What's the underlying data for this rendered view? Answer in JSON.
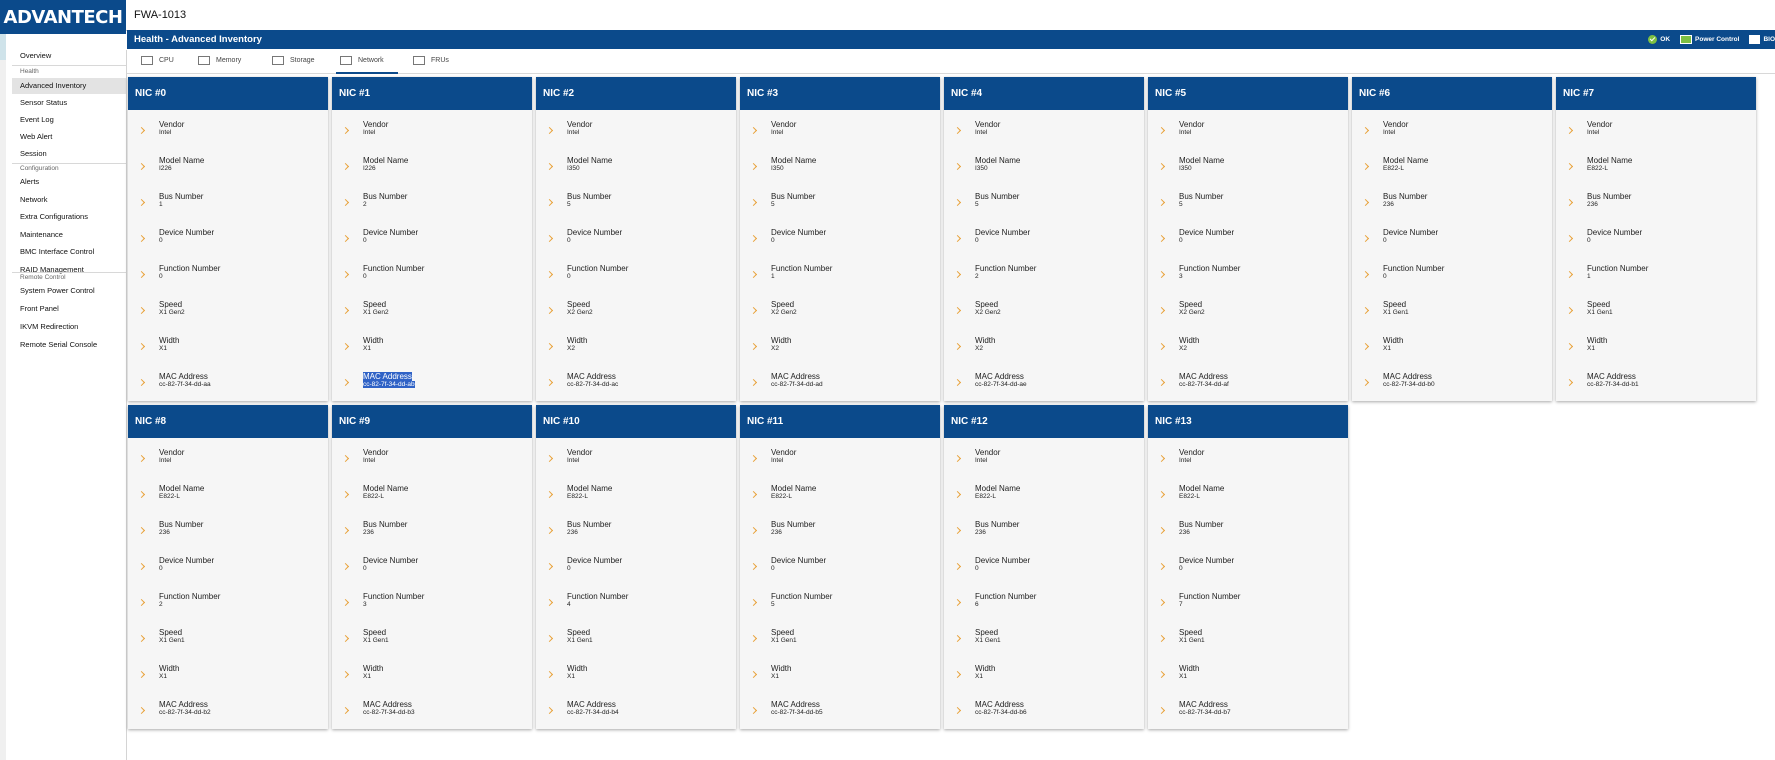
{
  "brand": {
    "logo_text": "ADVANTECH",
    "product": "FWA-1013"
  },
  "page_header": {
    "title": "Health - Advanced Inventory",
    "status": [
      {
        "label": "OK",
        "icon": "ok-check-icon"
      },
      {
        "label": "Power Control",
        "icon": "power-icon"
      },
      {
        "label": "BIO",
        "icon": "bios-icon"
      }
    ]
  },
  "tabs": [
    {
      "label": "CPU",
      "icon": "cpu-icon"
    },
    {
      "label": "Memory",
      "icon": "memory-icon"
    },
    {
      "label": "Storage",
      "icon": "storage-icon"
    },
    {
      "label": "Network",
      "icon": "network-icon",
      "active": true
    },
    {
      "label": "FRUs",
      "icon": "fru-icon"
    }
  ],
  "sidebar": {
    "overview": "Overview",
    "health_section": "Health",
    "health_items": [
      "Advanced Inventory",
      "Sensor Status",
      "Event Log",
      "Web Alert",
      "Session"
    ],
    "config_section": "Configuration",
    "config_items": [
      "Alerts",
      "Network",
      "Extra Configurations",
      "Maintenance",
      "BMC Interface Control",
      "RAID Management"
    ],
    "remote_section": "Remote Control",
    "remote_items": [
      "System Power Control",
      "Front Panel",
      "IKVM Redirection",
      "Remote Serial Console"
    ],
    "active_item": "Advanced Inventory"
  },
  "field_labels": {
    "vendor": "Vendor",
    "model": "Model Name",
    "bus": "Bus Number",
    "device": "Device Number",
    "function": "Function Number",
    "speed": "Speed",
    "width": "Width",
    "mac": "MAC Address"
  },
  "nics": [
    {
      "title": "NIC #0",
      "vendor": "Intel",
      "model": "I226",
      "bus": "1",
      "device": "0",
      "function": "0",
      "speed": "X1 Gen2",
      "width": "X1",
      "mac": "cc-82-7f-34-dd-aa"
    },
    {
      "title": "NIC #1",
      "vendor": "Intel",
      "model": "I226",
      "bus": "2",
      "device": "0",
      "function": "0",
      "speed": "X1 Gen2",
      "width": "X1",
      "mac": "cc-82-7f-34-dd-ab",
      "selected": true
    },
    {
      "title": "NIC #2",
      "vendor": "Intel",
      "model": "I350",
      "bus": "5",
      "device": "0",
      "function": "0",
      "speed": "X2 Gen2",
      "width": "X2",
      "mac": "cc-82-7f-34-dd-ac"
    },
    {
      "title": "NIC #3",
      "vendor": "Intel",
      "model": "I350",
      "bus": "5",
      "device": "0",
      "function": "1",
      "speed": "X2 Gen2",
      "width": "X2",
      "mac": "cc-82-7f-34-dd-ad"
    },
    {
      "title": "NIC #4",
      "vendor": "Intel",
      "model": "I350",
      "bus": "5",
      "device": "0",
      "function": "2",
      "speed": "X2 Gen2",
      "width": "X2",
      "mac": "cc-82-7f-34-dd-ae"
    },
    {
      "title": "NIC #5",
      "vendor": "Intel",
      "model": "I350",
      "bus": "5",
      "device": "0",
      "function": "3",
      "speed": "X2 Gen2",
      "width": "X2",
      "mac": "cc-82-7f-34-dd-af"
    },
    {
      "title": "NIC #6",
      "vendor": "Intel",
      "model": "E822-L",
      "bus": "236",
      "device": "0",
      "function": "0",
      "speed": "X1 Gen1",
      "width": "X1",
      "mac": "cc-82-7f-34-dd-b0"
    },
    {
      "title": "NIC #7",
      "vendor": "Intel",
      "model": "E822-L",
      "bus": "236",
      "device": "0",
      "function": "1",
      "speed": "X1 Gen1",
      "width": "X1",
      "mac": "cc-82-7f-34-dd-b1"
    },
    {
      "title": "NIC #8",
      "vendor": "Intel",
      "model": "E822-L",
      "bus": "236",
      "device": "0",
      "function": "2",
      "speed": "X1 Gen1",
      "width": "X1",
      "mac": "cc-82-7f-34-dd-b2"
    },
    {
      "title": "NIC #9",
      "vendor": "Intel",
      "model": "E822-L",
      "bus": "236",
      "device": "0",
      "function": "3",
      "speed": "X1 Gen1",
      "width": "X1",
      "mac": "cc-82-7f-34-dd-b3"
    },
    {
      "title": "NIC #10",
      "vendor": "Intel",
      "model": "E822-L",
      "bus": "236",
      "device": "0",
      "function": "4",
      "speed": "X1 Gen1",
      "width": "X1",
      "mac": "cc-82-7f-34-dd-b4"
    },
    {
      "title": "NIC #11",
      "vendor": "Intel",
      "model": "E822-L",
      "bus": "236",
      "device": "0",
      "function": "5",
      "speed": "X1 Gen1",
      "width": "X1",
      "mac": "cc-82-7f-34-dd-b5"
    },
    {
      "title": "NIC #12",
      "vendor": "Intel",
      "model": "E822-L",
      "bus": "236",
      "device": "0",
      "function": "6",
      "speed": "X1 Gen1",
      "width": "X1",
      "mac": "cc-82-7f-34-dd-b6"
    },
    {
      "title": "NIC #13",
      "vendor": "Intel",
      "model": "E822-L",
      "bus": "236",
      "device": "0",
      "function": "7",
      "speed": "X1 Gen1",
      "width": "X1",
      "mac": "cc-82-7f-34-dd-b7"
    }
  ],
  "colors": {
    "brand_blue": "#0b4a8b",
    "accent_orange": "#e8a23a",
    "ok_green": "#7dc043",
    "selection": "#2f62c6"
  }
}
